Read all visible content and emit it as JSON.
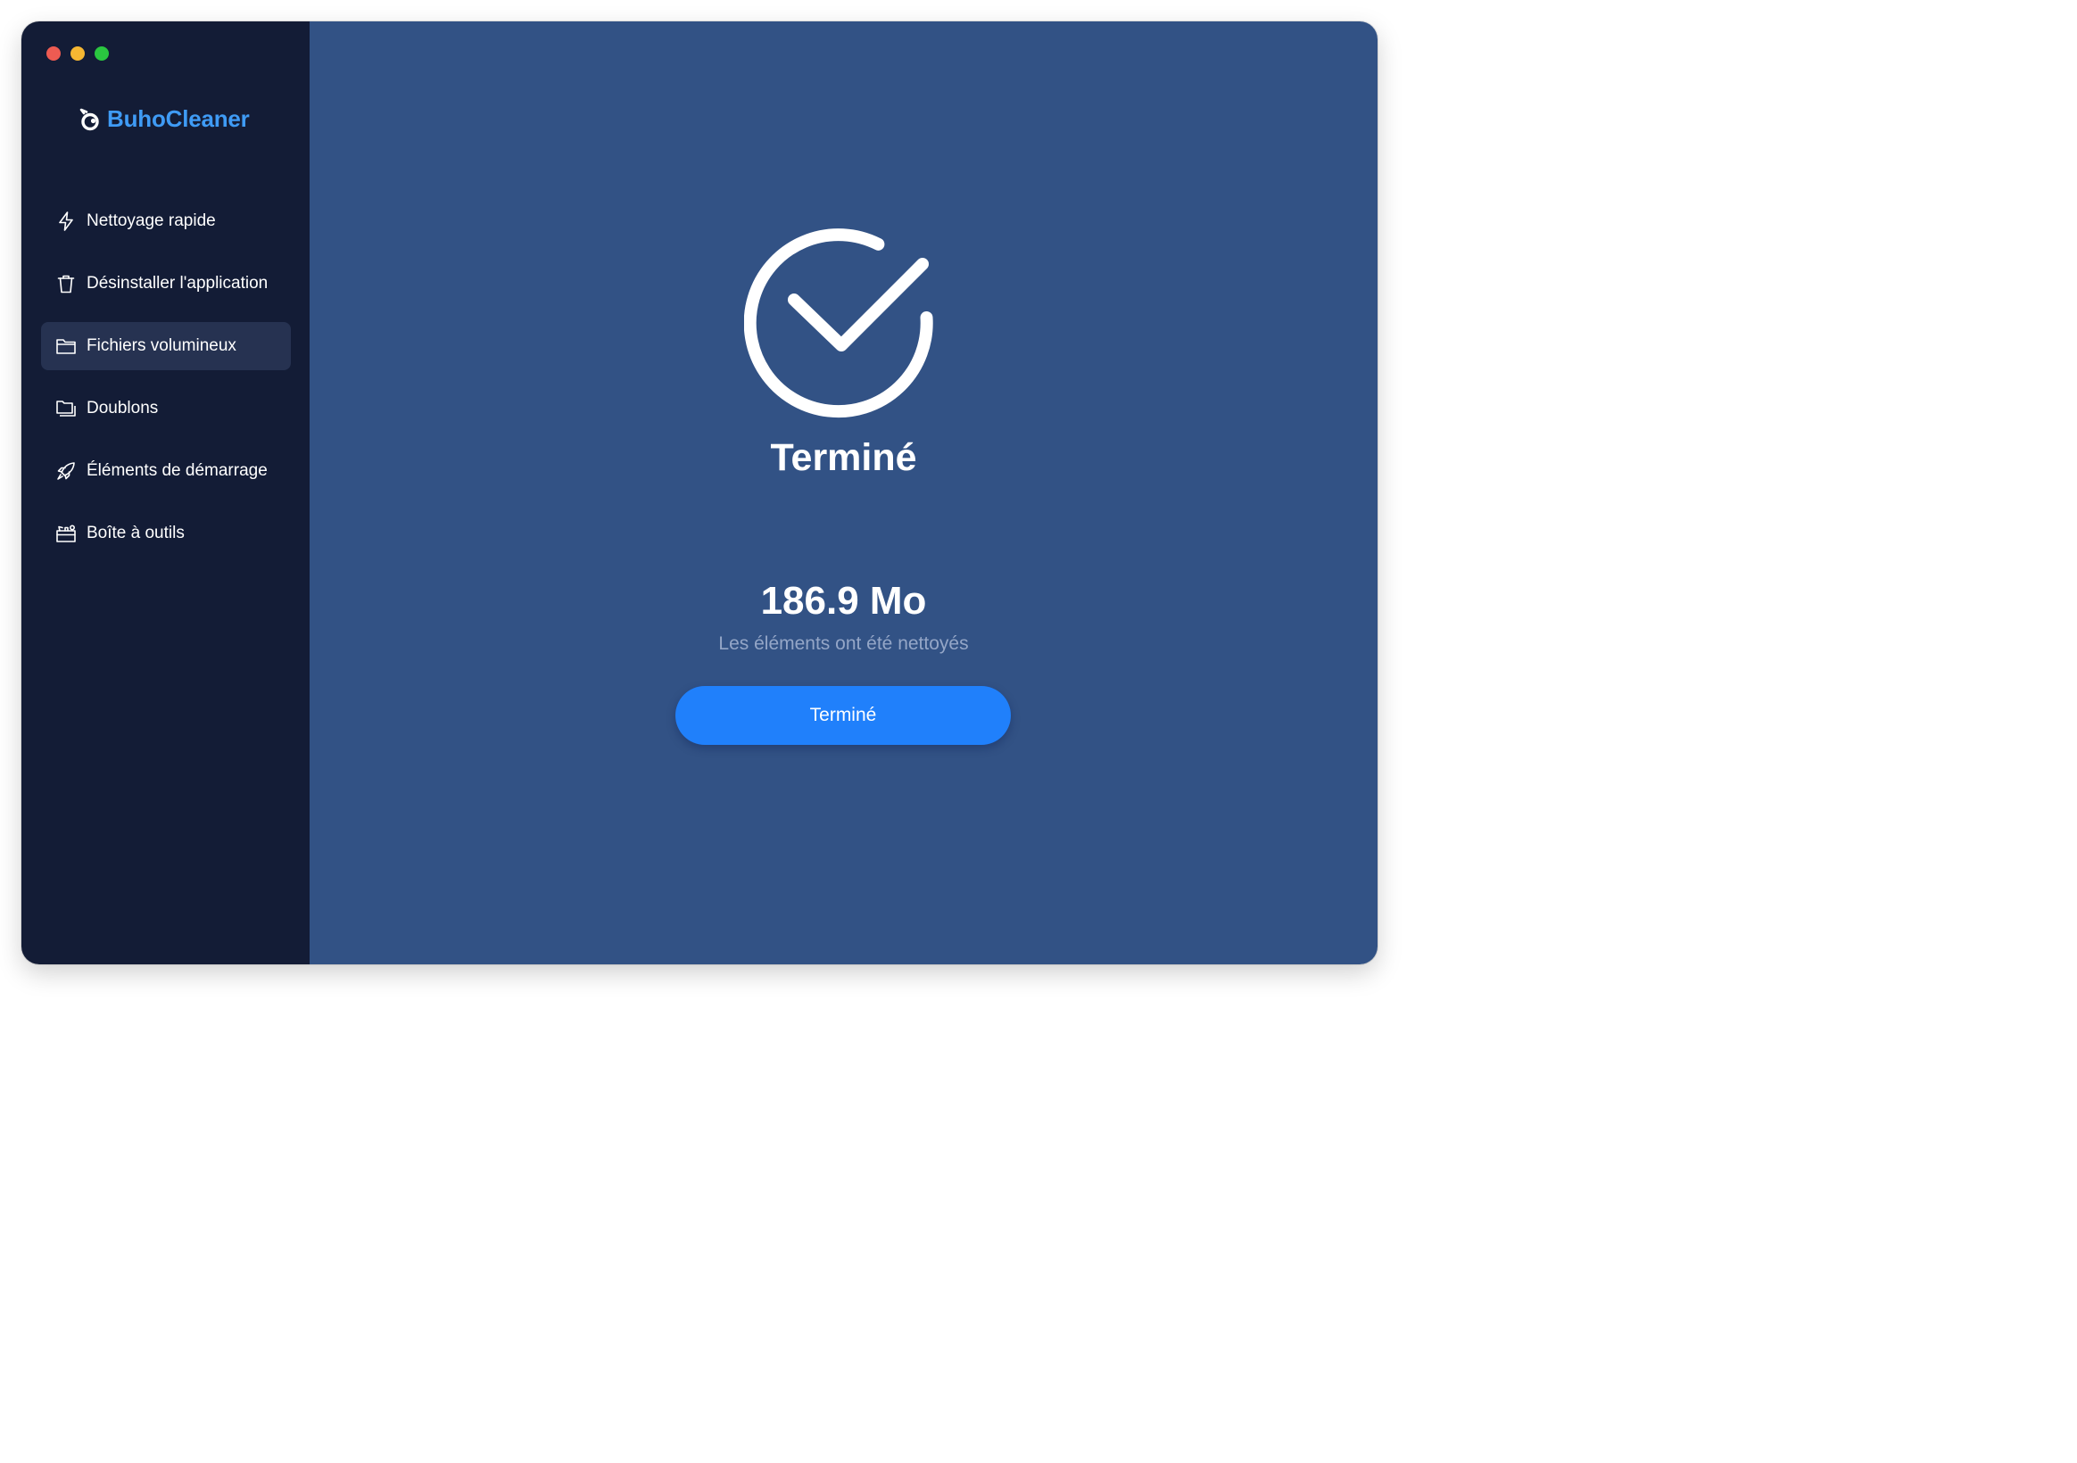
{
  "app": {
    "name": "BuhoCleaner"
  },
  "sidebar": {
    "items": [
      {
        "label": "Nettoyage rapide",
        "icon": "lightning-icon",
        "active": false
      },
      {
        "label": "Désinstaller l'application",
        "icon": "trash-icon",
        "active": false
      },
      {
        "label": "Fichiers volumineux",
        "icon": "folder-icon",
        "active": true
      },
      {
        "label": "Doublons",
        "icon": "duplicate-folder-icon",
        "active": false
      },
      {
        "label": "Éléments de démarrage",
        "icon": "rocket-icon",
        "active": false
      },
      {
        "label": "Boîte à outils",
        "icon": "toolbox-icon",
        "active": false
      }
    ]
  },
  "main": {
    "status_icon": "check-circle-icon",
    "status_title": "Terminé",
    "cleaned_size": "186.9 Mo",
    "cleaned_caption": "Les éléments ont été nettoyés",
    "done_button_label": "Terminé"
  },
  "colors": {
    "sidebar_bg": "#131c36",
    "sidebar_active_bg": "#263251",
    "main_bg": "#325285",
    "brand_blue": "#3f9bf5",
    "button_blue": "#2080fb",
    "caption_gray": "#94a6c7"
  }
}
